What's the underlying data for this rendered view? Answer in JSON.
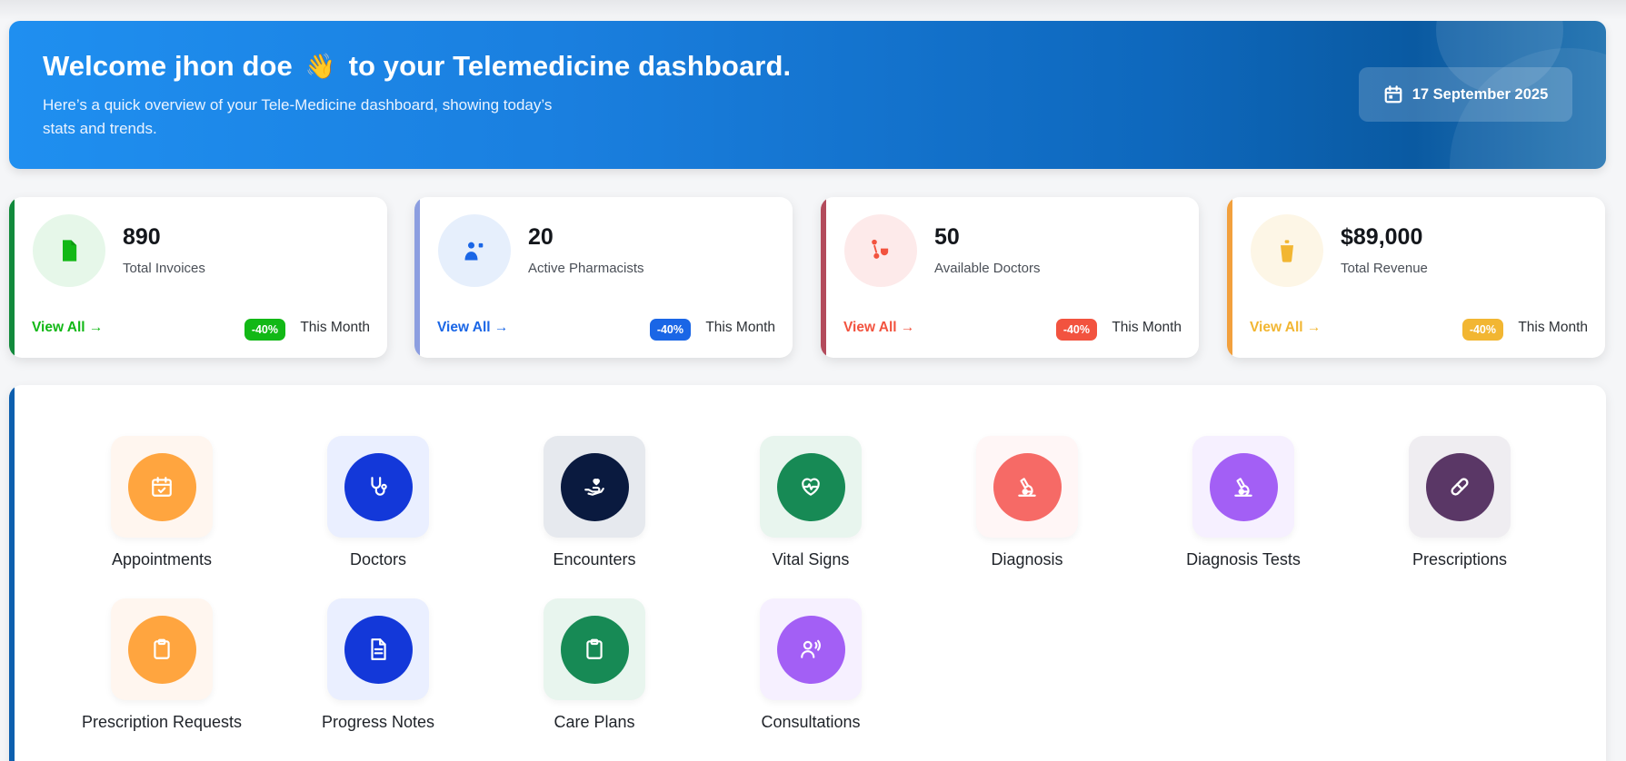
{
  "banner": {
    "title_part1": "Welcome jhon doe",
    "emoji": "👋",
    "title_part2": "to your Telemedicine dashboard.",
    "subtitle": "Here’s a quick overview of your Tele-Medicine dashboard, showing today’s stats and trends.",
    "date": "17 September 2025",
    "date_icon": "calendar-icon"
  },
  "stats": [
    {
      "value": "890",
      "label": "Total Invoices",
      "view": "View All →",
      "badge": "-40%",
      "period": "This Month",
      "icon": "file-icon",
      "accent": "#12b816",
      "bar": "#128a3c",
      "soft": "#e6f7e9"
    },
    {
      "value": "20",
      "label": "Active Pharmacists",
      "view": "View All →",
      "badge": "-40%",
      "period": "This Month",
      "icon": "pharmacist-icon",
      "accent": "#1a66e6",
      "bar": "#8c9ee0",
      "soft": "#e6effc"
    },
    {
      "value": "50",
      "label": "Available Doctors",
      "view": "View All →",
      "badge": "-40%",
      "period": "This Month",
      "icon": "doctor-icon",
      "accent": "#f2533f",
      "bar": "#b34b5c",
      "soft": "#fdeaea"
    },
    {
      "value": "$89,000",
      "label": "Total Revenue",
      "view": "View All →",
      "badge": "-40%",
      "period": "This Month",
      "icon": "revenue-icon",
      "accent": "#f2b632",
      "bar": "#f2a03d",
      "soft": "#fdf6e6"
    }
  ],
  "modules": [
    {
      "label": "Appointments",
      "icon": "calendar-check-icon",
      "color": "#ffa53f",
      "tile": "#fff6ef"
    },
    {
      "label": "Doctors",
      "icon": "stethoscope-icon",
      "color": "#1338d9",
      "tile": "#eaefff"
    },
    {
      "label": "Encounters",
      "icon": "hand-heart-icon",
      "color": "#0a1a3f",
      "tile": "#e6e9ee"
    },
    {
      "label": "Vital Signs",
      "icon": "heart-pulse-icon",
      "color": "#178a55",
      "tile": "#e8f5ee"
    },
    {
      "label": "Diagnosis",
      "icon": "microscope-icon",
      "color": "#f66a66",
      "tile": "#fff6f6"
    },
    {
      "label": "Diagnosis Tests",
      "icon": "microscope-icon",
      "color": "#a35ff5",
      "tile": "#f6f0ff"
    },
    {
      "label": "Prescriptions",
      "icon": "pill-icon",
      "color": "#5a3766",
      "tile": "#efedf1"
    },
    {
      "label": "Prescription Requests",
      "icon": "clipboard-icon",
      "color": "#ffa53f",
      "tile": "#fff6ef"
    },
    {
      "label": "Progress Notes",
      "icon": "document-icon",
      "color": "#1338d9",
      "tile": "#eaefff"
    },
    {
      "label": "Care Plans",
      "icon": "clipboard-icon",
      "color": "#178a55",
      "tile": "#e8f5ee"
    },
    {
      "label": "Consultations",
      "icon": "user-voice-icon",
      "color": "#a35ff5",
      "tile": "#f6f0ff"
    }
  ]
}
